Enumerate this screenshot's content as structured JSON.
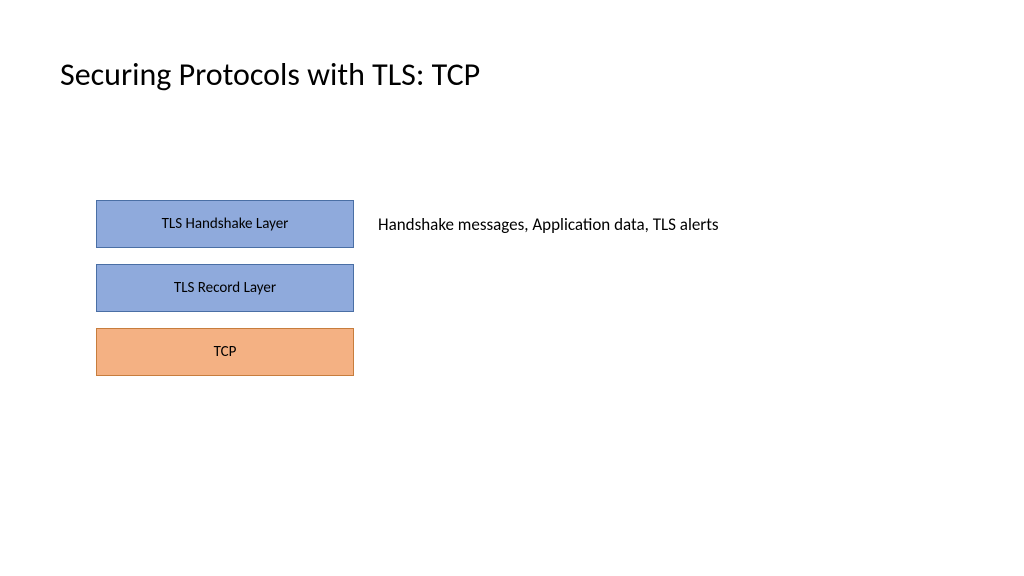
{
  "title": "Securing Protocols with TLS: TCP",
  "layers": [
    {
      "label": "TLS Handshake Layer",
      "colorClass": "layer-blue"
    },
    {
      "label": "TLS Record Layer",
      "colorClass": "layer-blue"
    },
    {
      "label": "TCP",
      "colorClass": "layer-orange"
    }
  ],
  "annotation": "Handshake messages, Application data, TLS alerts",
  "colors": {
    "blue": "#8faadc",
    "blueBorder": "#4a6fa5",
    "orange": "#f4b183",
    "orangeBorder": "#c77d3d"
  }
}
